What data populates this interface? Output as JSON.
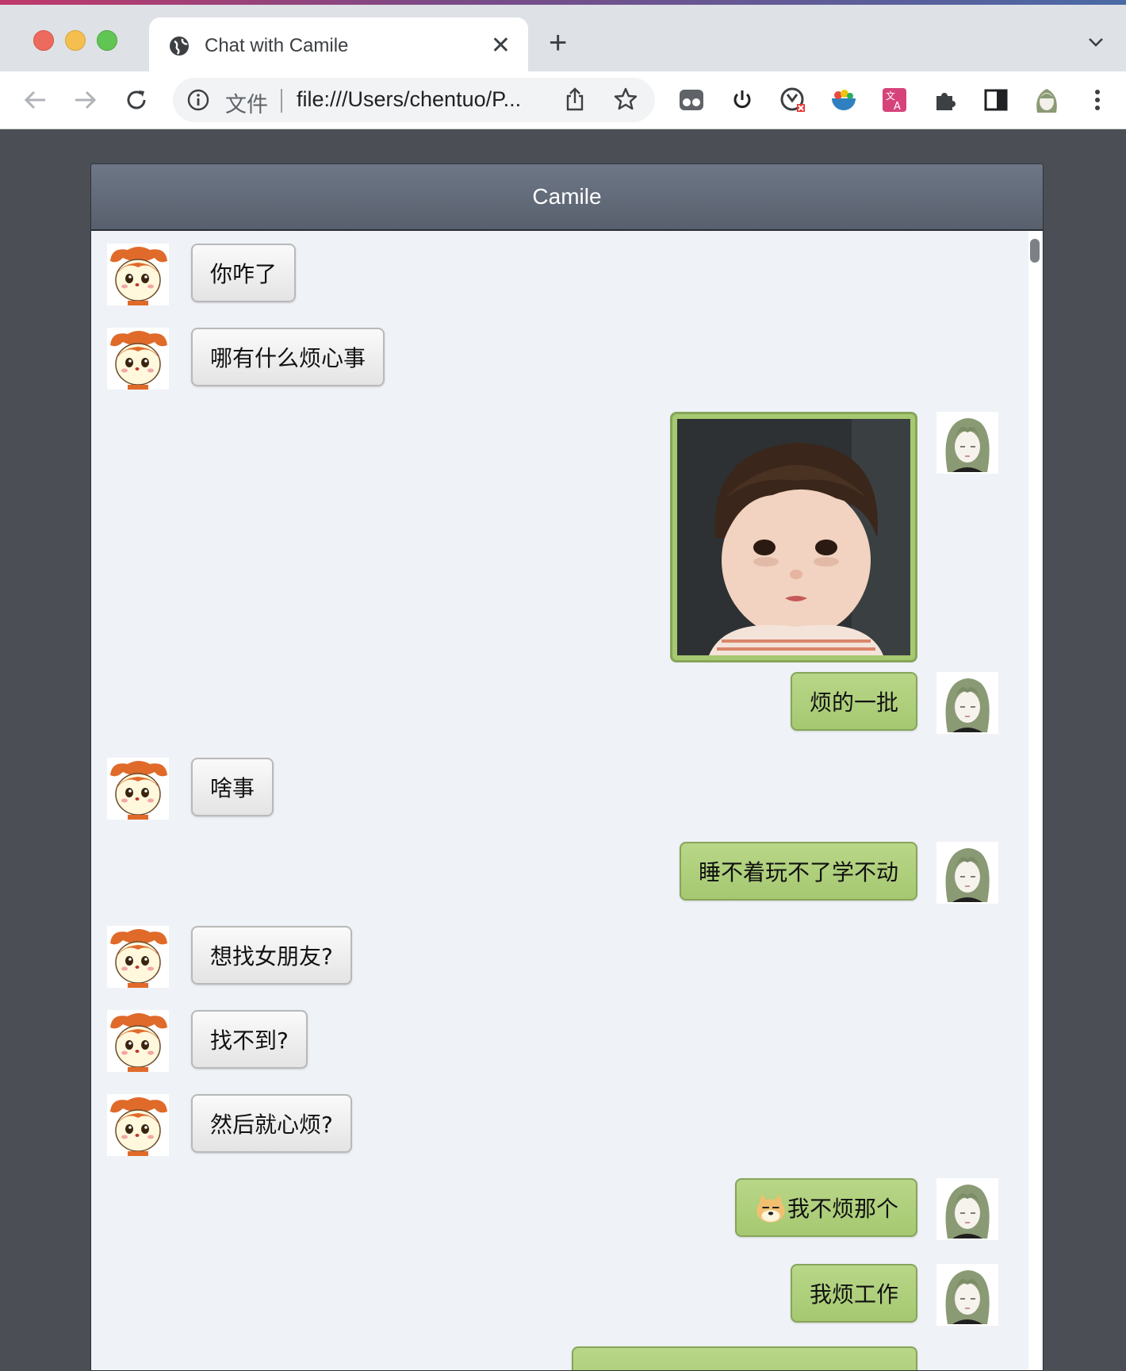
{
  "browser": {
    "tab_title": "Chat with Camile",
    "close_glyph": "✕",
    "newtab_glyph": "+",
    "omnibox_file_label": "文件",
    "url": "file:///Users/chentuo/P..."
  },
  "chat": {
    "title": "Camile",
    "messages": [
      {
        "side": "left",
        "text": "你咋了"
      },
      {
        "side": "left",
        "text": "哪有什么烦心事"
      },
      {
        "side": "right",
        "type": "image",
        "image": "toddler-photo"
      },
      {
        "side": "right",
        "text": "烦的一批"
      },
      {
        "side": "left",
        "text": "啥事"
      },
      {
        "side": "right",
        "text": "睡不着玩不了学不动"
      },
      {
        "side": "left",
        "text": "想找女朋友?"
      },
      {
        "side": "left",
        "text": "找不到?"
      },
      {
        "side": "left",
        "text": "然后就心烦?"
      },
      {
        "side": "right",
        "emoji": "doge-emoji",
        "text": "我不烦那个"
      },
      {
        "side": "right",
        "text": "我烦工作"
      }
    ]
  },
  "colors": {
    "self_bubble": "#a6c871",
    "other_bubble": "#ececec",
    "header": "#5f6776",
    "page_bg": "#4b4f55"
  }
}
